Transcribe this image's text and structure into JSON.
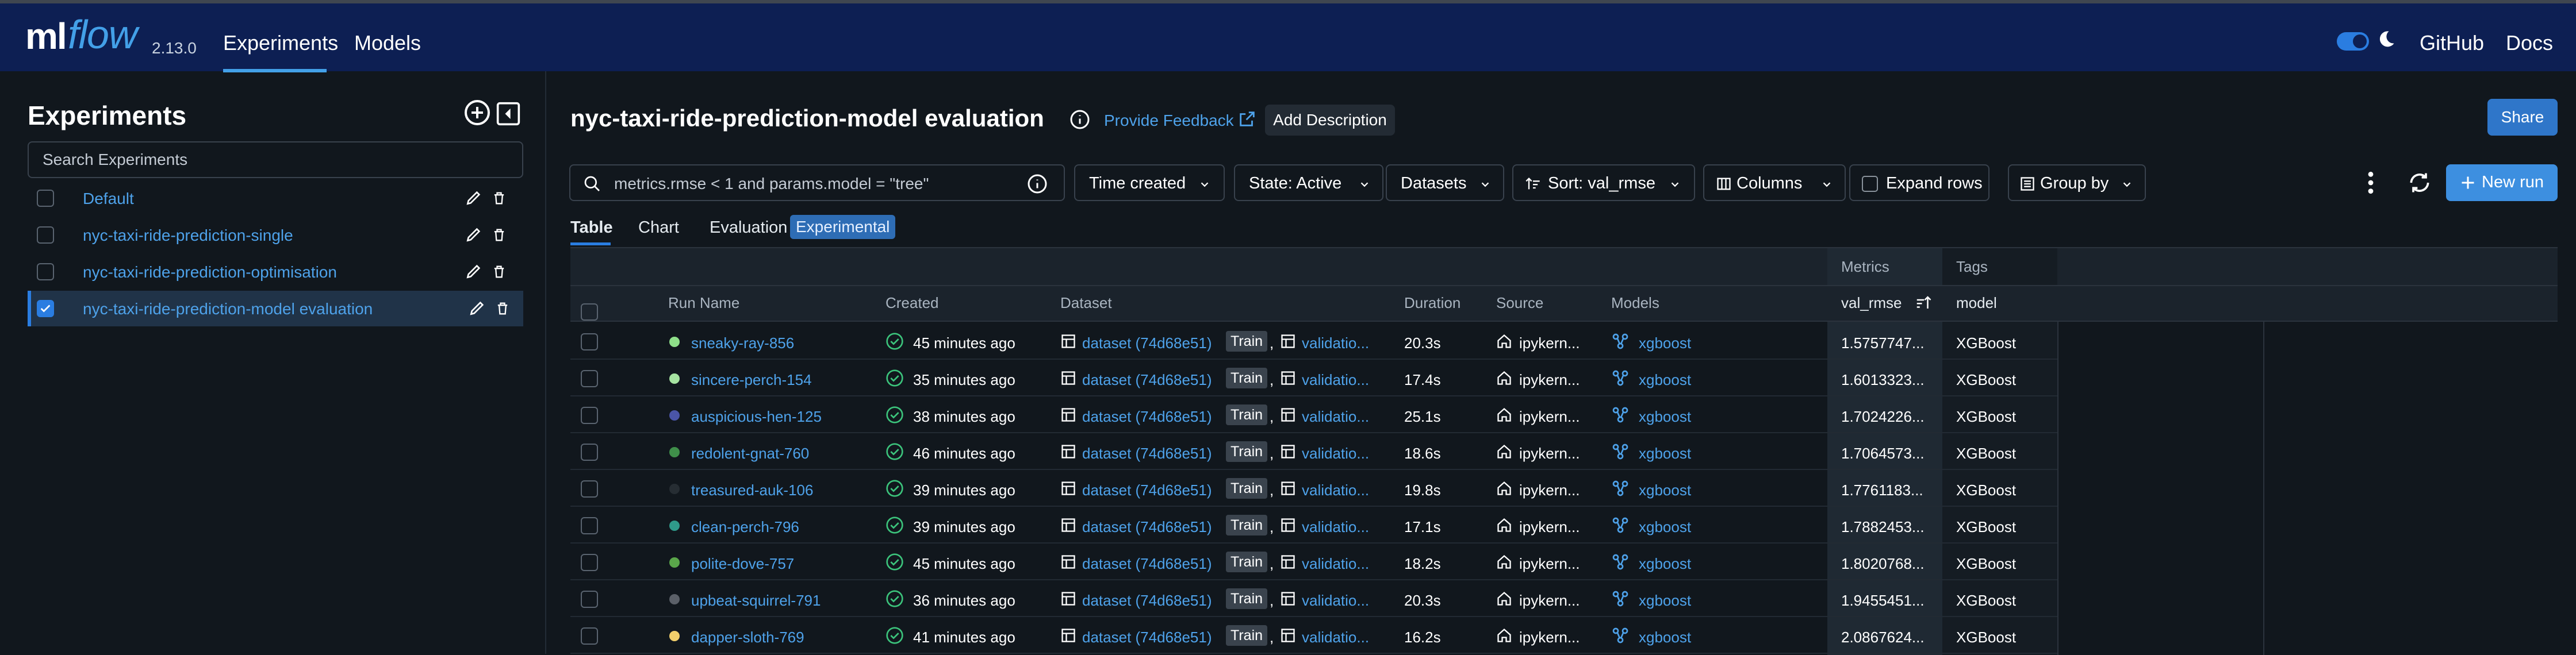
{
  "header": {
    "logo_ml": "ml",
    "logo_flow": "flow",
    "version": "2.13.0",
    "nav": {
      "experiments": "Experiments",
      "models": "Models",
      "github": "GitHub",
      "docs": "Docs"
    }
  },
  "sidebar": {
    "title": "Experiments",
    "search_placeholder": "Search Experiments",
    "experiments": [
      {
        "name": "Default",
        "selected": false
      },
      {
        "name": "nyc-taxi-ride-prediction-single",
        "selected": false
      },
      {
        "name": "nyc-taxi-ride-prediction-optimisation",
        "selected": false
      },
      {
        "name": "nyc-taxi-ride-prediction-model evaluation",
        "selected": true
      }
    ]
  },
  "main": {
    "title": "nyc-taxi-ride-prediction-model evaluation",
    "feedback": "Provide Feedback",
    "add_description": "Add Description",
    "share": "Share",
    "search_value": "metrics.rmse < 1 and params.model = \"tree\"",
    "toolbar": {
      "time": "Time created",
      "state": "State: Active",
      "datasets": "Datasets",
      "sort": "Sort: val_rmse",
      "columns": "Columns",
      "expand": "Expand rows",
      "group": "Group by",
      "new_run": "New run"
    },
    "tabs": {
      "table": "Table",
      "chart": "Chart",
      "evaluation": "Evaluation",
      "badge": "Experimental"
    }
  },
  "table": {
    "group_headers": {
      "metrics": "Metrics",
      "tags": "Tags"
    },
    "columns": {
      "run_name": "Run Name",
      "created": "Created",
      "dataset": "Dataset",
      "duration": "Duration",
      "source": "Source",
      "models": "Models",
      "metric": "val_rmse",
      "tag": "model"
    },
    "rows": [
      {
        "name": "sneaky-ray-856",
        "color": "#8fe08a",
        "created": "45 minutes ago",
        "dataset": "dataset (74d68e51)",
        "train": "Train",
        "valid": "validatio...",
        "duration": "20.3s",
        "source": "ipykern...",
        "model": "xgboost",
        "metric": "1.5757747...",
        "tag": "XGBoost"
      },
      {
        "name": "sincere-perch-154",
        "color": "#a6e3a1",
        "created": "35 minutes ago",
        "dataset": "dataset (74d68e51)",
        "train": "Train",
        "valid": "validatio...",
        "duration": "17.4s",
        "source": "ipykern...",
        "model": "xgboost",
        "metric": "1.6013323...",
        "tag": "XGBoost"
      },
      {
        "name": "auspicious-hen-125",
        "color": "#4a55a8",
        "created": "38 minutes ago",
        "dataset": "dataset (74d68e51)",
        "train": "Train",
        "valid": "validatio...",
        "duration": "25.1s",
        "source": "ipykern...",
        "model": "xgboost",
        "metric": "1.7024226...",
        "tag": "XGBoost"
      },
      {
        "name": "redolent-gnat-760",
        "color": "#3f8f4a",
        "created": "46 minutes ago",
        "dataset": "dataset (74d68e51)",
        "train": "Train",
        "valid": "validatio...",
        "duration": "18.6s",
        "source": "ipykern...",
        "model": "xgboost",
        "metric": "1.7064573...",
        "tag": "XGBoost"
      },
      {
        "name": "treasured-auk-106",
        "color": "#262d33",
        "created": "39 minutes ago",
        "dataset": "dataset (74d68e51)",
        "train": "Train",
        "valid": "validatio...",
        "duration": "19.8s",
        "source": "ipykern...",
        "model": "xgboost",
        "metric": "1.7761183...",
        "tag": "XGBoost"
      },
      {
        "name": "clean-perch-796",
        "color": "#2f9a8a",
        "created": "39 minutes ago",
        "dataset": "dataset (74d68e51)",
        "train": "Train",
        "valid": "validatio...",
        "duration": "17.1s",
        "source": "ipykern...",
        "model": "xgboost",
        "metric": "1.7882453...",
        "tag": "XGBoost"
      },
      {
        "name": "polite-dove-757",
        "color": "#5aa64a",
        "created": "45 minutes ago",
        "dataset": "dataset (74d68e51)",
        "train": "Train",
        "valid": "validatio...",
        "duration": "18.2s",
        "source": "ipykern...",
        "model": "xgboost",
        "metric": "1.8020768...",
        "tag": "XGBoost"
      },
      {
        "name": "upbeat-squirrel-791",
        "color": "#5b6068",
        "created": "36 minutes ago",
        "dataset": "dataset (74d68e51)",
        "train": "Train",
        "valid": "validatio...",
        "duration": "20.3s",
        "source": "ipykern...",
        "model": "xgboost",
        "metric": "1.9455451...",
        "tag": "XGBoost"
      },
      {
        "name": "dapper-sloth-769",
        "color": "#f2cf6b",
        "created": "41 minutes ago",
        "dataset": "dataset (74d68e51)",
        "train": "Train",
        "valid": "validatio...",
        "duration": "16.2s",
        "source": "ipykern...",
        "model": "xgboost",
        "metric": "2.0867624...",
        "tag": "XGBoost"
      }
    ]
  }
}
